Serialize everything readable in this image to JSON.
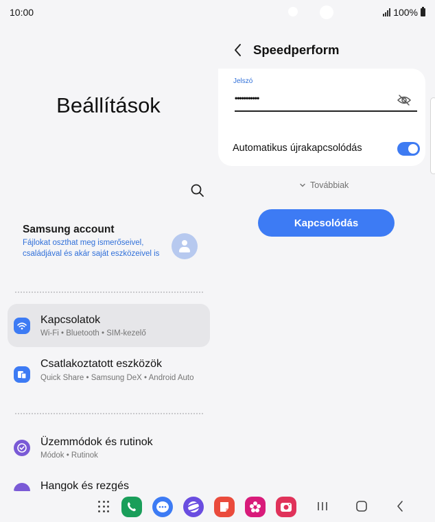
{
  "status": {
    "time": "10:00",
    "battery": "100%"
  },
  "left": {
    "title": "Beállítások",
    "search_icon": "search-icon",
    "account": {
      "name": "Samsung account",
      "description": "Fájlokat oszthat meg ismerőseivel, családjával és akár saját eszközeivel is"
    },
    "items": [
      {
        "title": "Kapcsolatok",
        "subtitle": "Wi-Fi  •  Bluetooth  •  SIM-kezelő",
        "icon": "wifi-icon",
        "color": "#3d7bf4"
      },
      {
        "title": "Csatlakoztatott eszközök",
        "subtitle": "Quick Share  •  Samsung DeX  •  Android Auto",
        "icon": "devices-icon",
        "color": "#3d7bf4"
      },
      {
        "title": "Üzemmódok és rutinok",
        "subtitle": "Módok  •  Rutinok",
        "icon": "modes-icon",
        "color": "#7a5ad6"
      },
      {
        "title": "Hangok és rezgés",
        "subtitle": "",
        "icon": "sound-icon",
        "color": "#7a5ad6"
      }
    ]
  },
  "right": {
    "title": "Speedperform",
    "password_label": "Jelszó",
    "password_value": "•••••••••••",
    "auto_reconnect_label": "Automatikus újrakapcsolódás",
    "auto_reconnect_on": true,
    "more_label": "Továbbiak",
    "connect_label": "Kapcsolódás"
  },
  "dock": {
    "apps": [
      {
        "name": "phone-icon",
        "color": "#1a9e5a"
      },
      {
        "name": "messages-icon",
        "color": "#3d7bf4"
      },
      {
        "name": "internet-icon",
        "color": "#6a4de0"
      },
      {
        "name": "notes-icon",
        "color": "#ea4b3c"
      },
      {
        "name": "bixby-icon",
        "color": "#d81b7a"
      },
      {
        "name": "camera-icon",
        "color": "#e0325a"
      }
    ]
  }
}
